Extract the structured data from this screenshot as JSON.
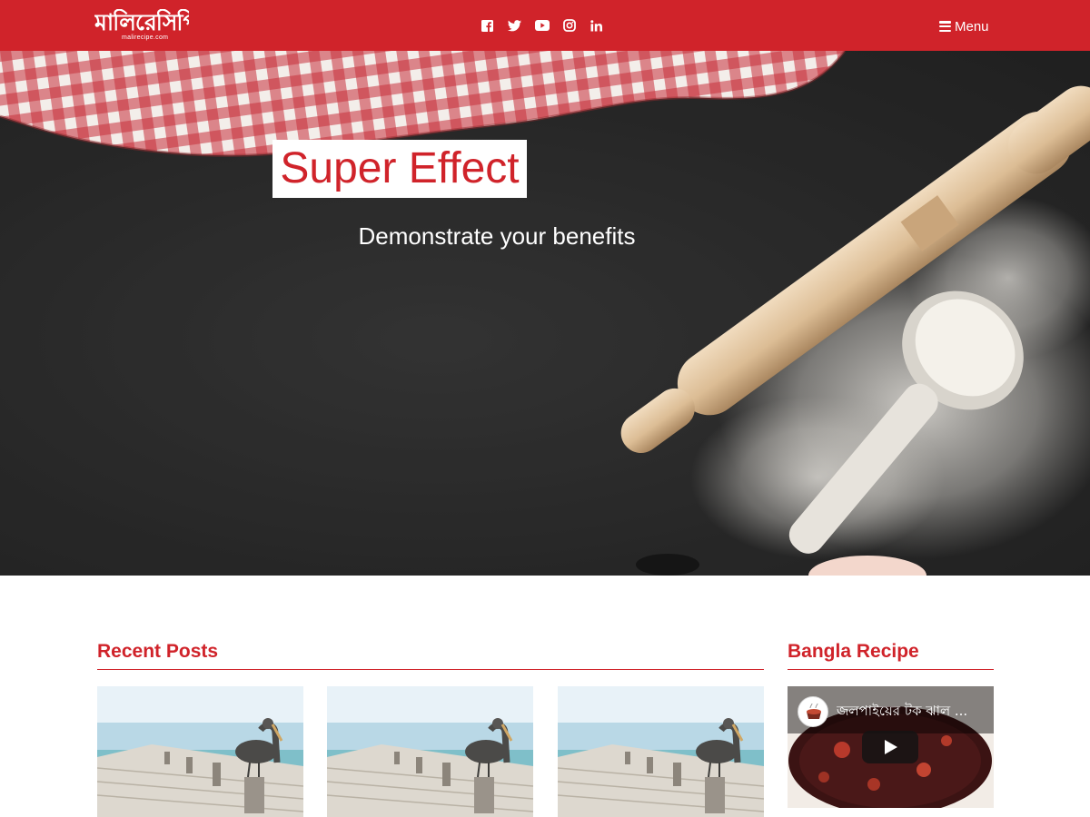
{
  "site": {
    "logo_text": "মালিরেসিপি",
    "logo_domain": "malirecipe.com",
    "brand_color": "#d0232a"
  },
  "header": {
    "social_icons": [
      "facebook-icon",
      "twitter-icon",
      "youtube-icon",
      "instagram-icon",
      "linkedin-icon"
    ],
    "menu_label": "Menu"
  },
  "hero": {
    "title": "Super Effect",
    "subtitle": "Demonstrate your benefits"
  },
  "recent_posts": {
    "heading": "Recent Posts",
    "count_visible": 3
  },
  "sidebar": {
    "heading": "Bangla Recipe",
    "video_title": "জলপাইয়ের টক ঝাল ..."
  }
}
